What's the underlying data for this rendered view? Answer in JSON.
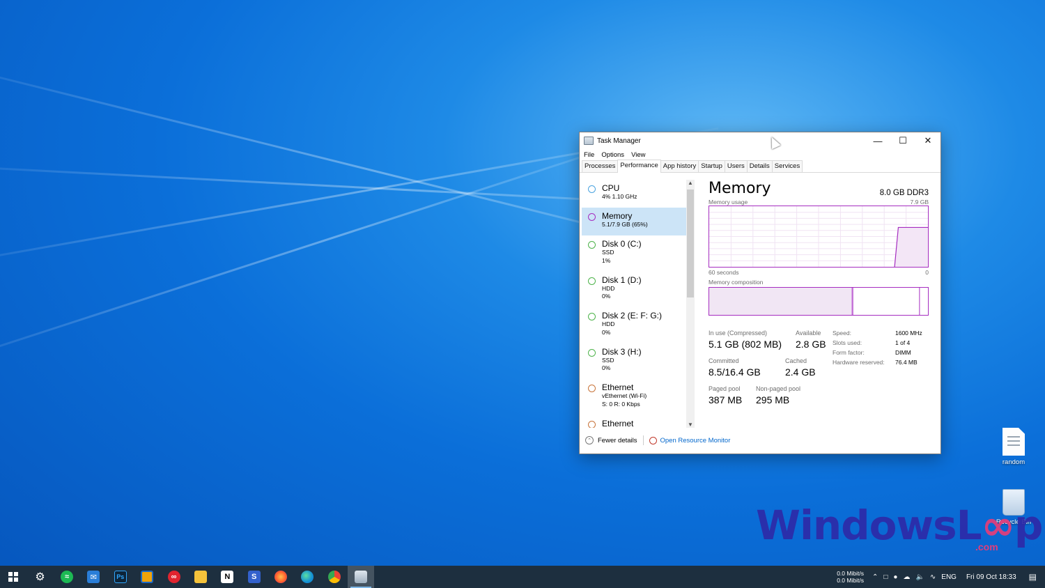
{
  "window": {
    "title": "Task Manager",
    "menu": [
      "File",
      "Options",
      "View"
    ],
    "tabs": [
      "Processes",
      "Performance",
      "App history",
      "Startup",
      "Users",
      "Details",
      "Services"
    ],
    "active_tab": "Performance"
  },
  "resources": [
    {
      "name": "CPU",
      "line1": "4%  1.10 GHz",
      "line2": "",
      "color": "#4aa3df"
    },
    {
      "name": "Memory",
      "line1": "5.1/7.9 GB (65%)",
      "line2": "",
      "color": "#a52cc0"
    },
    {
      "name": "Disk 0 (C:)",
      "line1": "SSD",
      "line2": "1%",
      "color": "#4db34a"
    },
    {
      "name": "Disk 1 (D:)",
      "line1": "HDD",
      "line2": "0%",
      "color": "#4db34a"
    },
    {
      "name": "Disk 2 (E: F: G:)",
      "line1": "HDD",
      "line2": "0%",
      "color": "#4db34a"
    },
    {
      "name": "Disk 3 (H:)",
      "line1": "SSD",
      "line2": "0%",
      "color": "#4db34a"
    },
    {
      "name": "Ethernet",
      "line1": "vEthernet (Wi-Fi)",
      "line2": "S: 0  R: 0 Kbps",
      "color": "#c8743a"
    },
    {
      "name": "Ethernet",
      "line1": "",
      "line2": "",
      "color": "#c8743a"
    }
  ],
  "memory": {
    "heading": "Memory",
    "spec": "8.0 GB DDR3",
    "usage_label": "Memory usage",
    "usage_max": "7.9 GB",
    "time_left": "60 seconds",
    "time_right": "0",
    "composition_label": "Memory composition",
    "stats": {
      "in_use_label": "In use (Compressed)",
      "in_use": "5.1 GB (802 MB)",
      "available_label": "Available",
      "available": "2.8 GB",
      "committed_label": "Committed",
      "committed": "8.5/16.4 GB",
      "cached_label": "Cached",
      "cached": "2.4 GB",
      "paged_label": "Paged pool",
      "paged": "387 MB",
      "nonpaged_label": "Non-paged pool",
      "nonpaged": "295 MB"
    },
    "specs": [
      {
        "k": "Speed:",
        "v": "1600 MHz"
      },
      {
        "k": "Slots used:",
        "v": "1 of 4"
      },
      {
        "k": "Form factor:",
        "v": "DIMM"
      },
      {
        "k": "Hardware reserved:",
        "v": "76.4 MB"
      }
    ],
    "usage_history_fraction": [
      0,
      0,
      0,
      0,
      0,
      0,
      0,
      0,
      0,
      0,
      0,
      0,
      0,
      0,
      0,
      0,
      0,
      0,
      0,
      0,
      0,
      0,
      0,
      0,
      0,
      0,
      0,
      0,
      0,
      0,
      0,
      0,
      0,
      0,
      0,
      0,
      0,
      0,
      0,
      0,
      0,
      0,
      0,
      0,
      0,
      0,
      0,
      0,
      0,
      0,
      0,
      0.65,
      0.65,
      0.65,
      0.65,
      0.65,
      0.65,
      0.65,
      0.65,
      0.65
    ],
    "composition_in_use_fraction": 0.65,
    "composition_modified_fraction": 0.005,
    "composition_standby_fraction": 0.305
  },
  "footer": {
    "fewer": "Fewer details",
    "monitor": "Open Resource Monitor"
  },
  "desktop": {
    "file_label": "random",
    "bin_label": "Recycle Bin"
  },
  "watermark": {
    "part1": "Windows",
    "part2": "L",
    "part3": "p",
    "sub": ".com"
  },
  "tray": {
    "net_up": "0.0 Mibit/s",
    "net_down": "0.0 Mibit/s",
    "lang": "ENG",
    "datetime": "Fri 09 Oct 18:33"
  },
  "taskbar_apps": [
    "settings-icon",
    "spotify-icon",
    "mail-icon",
    "photoshop-icon",
    "virtualbox-icon",
    "creative-cloud-icon",
    "file-explorer-icon",
    "notion-icon",
    "simplenote-icon",
    "firefox-icon",
    "edge-icon",
    "chrome-icon",
    "task-manager-icon"
  ]
}
